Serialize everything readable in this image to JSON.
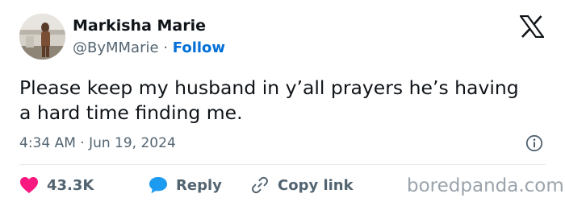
{
  "author": {
    "display_name": "Markisha Marie",
    "handle": "@ByMMarie",
    "separator": "·",
    "follow_label": "Follow"
  },
  "tweet": {
    "text": "Please keep my husband in y’all prayers he’s having a hard time finding me.",
    "timestamp": "4:34 AM · Jun 19, 2024"
  },
  "actions": {
    "likes_count": "43.3K",
    "reply_label": "Reply",
    "copy_link_label": "Copy link"
  },
  "watermark": "boredpanda.com",
  "icons": {
    "brand": "x-logo-icon",
    "info": "info-icon",
    "like": "heart-icon",
    "reply": "speech-bubble-icon",
    "copy_link": "link-icon"
  },
  "colors": {
    "text": "#0f1419",
    "muted": "#536471",
    "link_blue": "#006fd6",
    "heart_red": "#f91880",
    "reply_blue": "#1d9bf0",
    "divider": "#e6eaed"
  }
}
